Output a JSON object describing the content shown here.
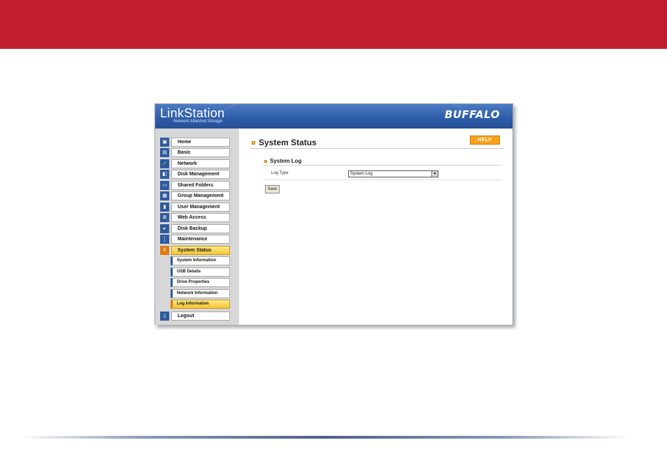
{
  "header": {
    "brand_title": "LinkStation",
    "brand_subtitle": "Network Attached Storage",
    "vendor_logo": "BUFFALO"
  },
  "sidebar": {
    "items": [
      {
        "label": "Home",
        "icon": "home-icon"
      },
      {
        "label": "Basic",
        "icon": "document-icon"
      },
      {
        "label": "Network",
        "icon": "network-icon"
      },
      {
        "label": "Disk Management",
        "icon": "disk-icon"
      },
      {
        "label": "Shared Folders",
        "icon": "folder-icon"
      },
      {
        "label": "Group Management",
        "icon": "group-icon"
      },
      {
        "label": "User Management",
        "icon": "user-icon"
      },
      {
        "label": "Web Access",
        "icon": "web-icon"
      },
      {
        "label": "Disk Backup",
        "icon": "backup-icon"
      },
      {
        "label": "Maintenance",
        "icon": "tools-icon"
      },
      {
        "label": "System Status",
        "icon": "status-icon"
      },
      {
        "label": "Logout",
        "icon": "logout-icon"
      }
    ],
    "sub_items": [
      {
        "label": "System Information"
      },
      {
        "label": "USB Details"
      },
      {
        "label": "Drive Properties"
      },
      {
        "label": "Network Information"
      },
      {
        "label": "Log Information"
      }
    ],
    "active_item": "System Status",
    "active_sub_item": "Log Information"
  },
  "main": {
    "page_title": "System Status",
    "help_label": "HELP",
    "section_title": "System Log",
    "log_type_label": "Log Type",
    "log_type_value": "System Log",
    "save_label": "Save"
  },
  "colors": {
    "banner": "#c21f2e",
    "header_blue": "#2d5ca8",
    "active_orange": "#f4c531",
    "help_orange": "#f7a21b"
  }
}
